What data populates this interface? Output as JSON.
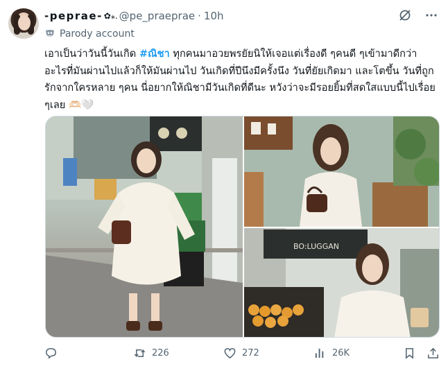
{
  "tweet": {
    "display_name": "-peprae-",
    "name_symbols": "✿⁎.",
    "handle": "@pe_praeprae",
    "dot": "·",
    "time": "10h",
    "label": "Parody account",
    "text_part1": "เอาเป็นว่าวันนี้วันเกิด ",
    "hashtag": "#ณิชา",
    "text_part2": " ทุกคนมาอวยพรยัยนิให้เจอแต่เรื่องดี ๆคนดี ๆเข้ามาดีกว่า อะไรที่มันผ่านไปแล้วก็ให้มันผ่านไป วันเกิดที่ปีนึงมีครั้งนึง วันที่ยัยเกิดมา และโตขึ้น วันที่ถูกรักจากใครหลาย ๆคน นี่อยากให้ณิชามีวันเกิดที่ดีนะ หวังว่าจะมีรอยยิ้มที่สดใสแบบนี้ไปเรื่อย ๆเลย 🫶🏻🤍",
    "shop_sign": "BO:LUGGAN",
    "stats": {
      "replies": "",
      "retweets": "226",
      "likes": "272",
      "views": "26K"
    }
  },
  "icons": {
    "avatar": "user-avatar",
    "mask": "parody-mask-icon",
    "grok": "grok-icon",
    "more": "more-icon",
    "reply": "reply-icon",
    "retweet": "retweet-icon",
    "like": "heart-icon",
    "views": "views-icon",
    "bookmark": "bookmark-icon",
    "share": "share-icon"
  },
  "colors": {
    "hashtag": "#1d9bf0",
    "secondary_text": "#536471",
    "primary_text": "#0f1419"
  }
}
